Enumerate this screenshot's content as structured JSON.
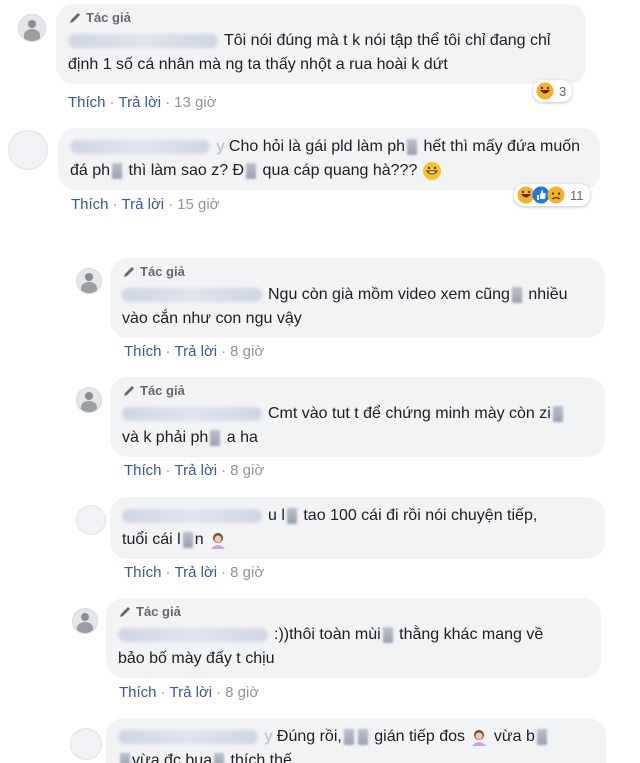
{
  "labels": {
    "author_badge": "Tác giả",
    "like": "Thích",
    "reply": "Trả lời",
    "sep": "·"
  },
  "comments": [
    {
      "author_badge": true,
      "text": "Tôi nói đúng mà t k nói tập thể tôi chỉ đang chỉ định 1 số cá nhân mà ng ta thấy nhột a rua hoài k dứt",
      "time": "13 giờ",
      "reaction_count": "3"
    },
    {
      "author_badge": false,
      "name_visible": "y",
      "text_a": "Cho hỏi là gái pld làm ph",
      "text_b": " hết thì mấy đứa muốn đá ph",
      "text_c": " thì làm sao z? Đ",
      "text_d": " qua cáp quang hà???",
      "time": "15 giờ",
      "reaction_count": "11"
    },
    {
      "author_badge": true,
      "text_a": "Ngu còn già mồm video xem cũng",
      "text_b": " nhiều vào cắn như con ngu vậy",
      "time": "8 giờ"
    },
    {
      "author_badge": true,
      "text_a": "Cmt vào tut t để chứng minh mày còn zi",
      "text_b": "và k phải ph",
      "text_c": " a ha",
      "time": "8 giờ"
    },
    {
      "author_badge": false,
      "text_a": "u l",
      "text_b": " tao 100 cái đi rồi nói chuyện tiếp,",
      "text_c": "tuổi cái l",
      "text_d": "n",
      "time": "8 giờ"
    },
    {
      "author_badge": true,
      "text_a": ":))thôi toàn mùi",
      "text_b": " thằng khác mang về",
      "text_c": "bảo bố mày đấy t chịu",
      "time": "8 giờ"
    },
    {
      "author_badge": false,
      "name_visible": "y",
      "text_a": "Đúng rồi,",
      "text_b": " gián tiếp đos",
      "text_c": " vừa b",
      "text_d": "vừa đc bua",
      "text_e": " thích thế"
    }
  ],
  "colors": {
    "link": "#385898",
    "meta": "#90949c",
    "bubble": "#f2f3f5",
    "haha": "#f7b125",
    "like": "#1877f2",
    "sad": "#f7b125"
  },
  "icons": [
    "pen-icon",
    "haha-emoji",
    "like-reaction-icon",
    "sad-reaction-icon",
    "hand-emoji",
    "grin-emoji"
  ]
}
